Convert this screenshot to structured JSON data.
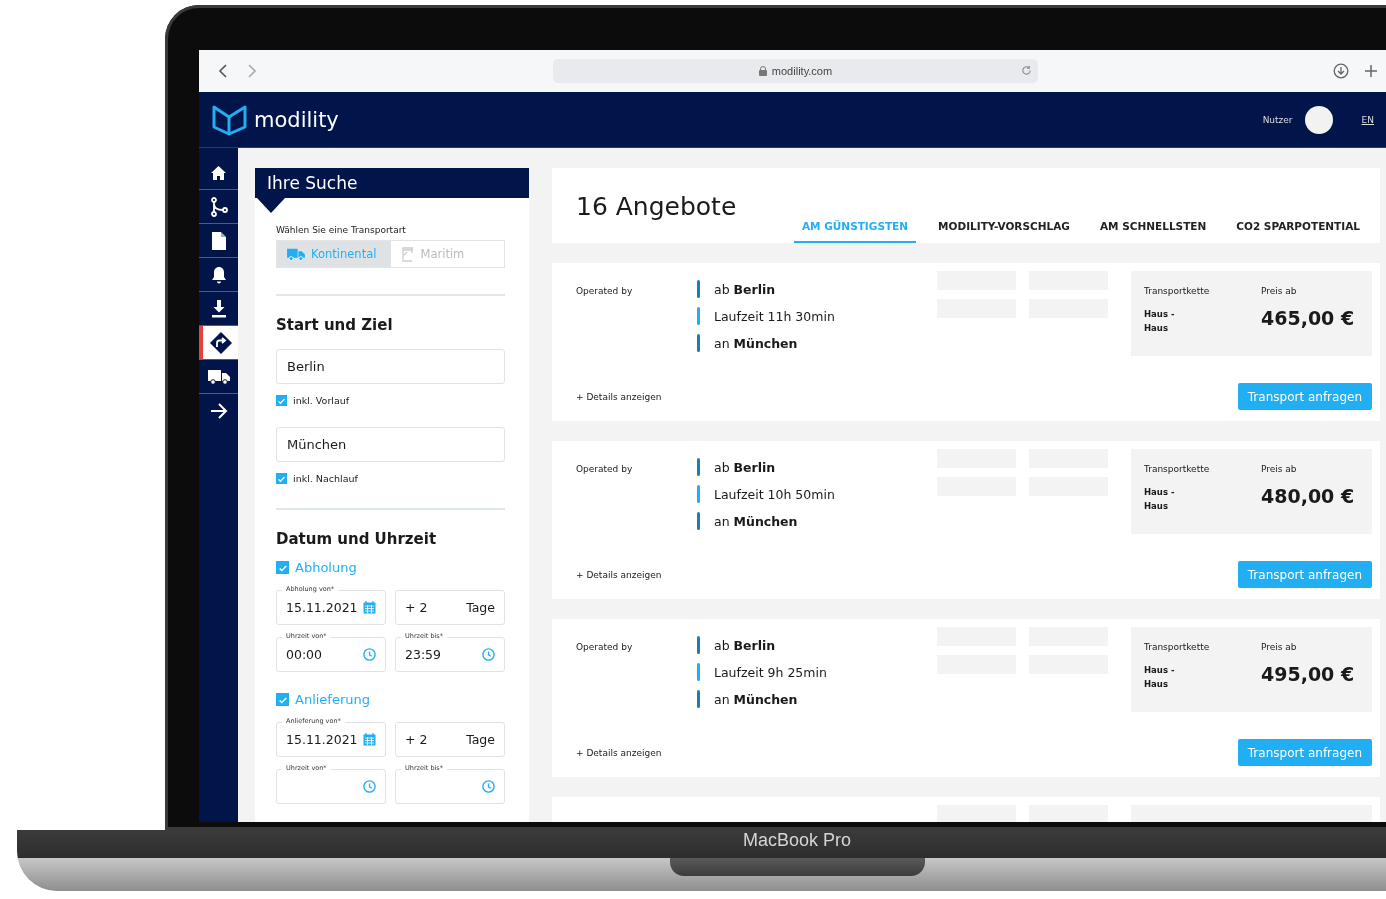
{
  "laptop": {
    "label": "MacBook Pro"
  },
  "browser": {
    "url": "modility.com"
  },
  "header": {
    "logo": "modility",
    "user_label": "Nutzer",
    "language": "EN"
  },
  "sidebar": {
    "items": [
      {
        "kind": "home",
        "selected": false
      },
      {
        "kind": "branch",
        "selected": false
      },
      {
        "kind": "document",
        "selected": false
      },
      {
        "kind": "bell",
        "selected": false
      },
      {
        "kind": "download",
        "selected": false
      },
      {
        "kind": "route",
        "selected": true
      },
      {
        "kind": "truck",
        "selected": false
      },
      {
        "kind": "arrow",
        "selected": false
      }
    ]
  },
  "search": {
    "title": "Ihre Suche",
    "transport_label": "Wählen Sie eine Transportart",
    "transport_modes": [
      {
        "label": "Kontinental",
        "kind": "truck",
        "selected": true
      },
      {
        "label": "Maritim",
        "kind": "crane",
        "selected": false
      }
    ],
    "route_title": "Start und Ziel",
    "route_fields": [
      {
        "value": "Berlin",
        "option": {
          "label": "inkl. Vorlauf",
          "checked": true
        }
      },
      {
        "value": "München",
        "option": {
          "label": "inkl. Nachlauf",
          "checked": true
        }
      }
    ],
    "schedule_title": "Datum und Uhrzeit",
    "schedule": [
      {
        "label": "Abholung",
        "checked": true,
        "date": {
          "label": "Abholung von*",
          "value": "15.11.2021"
        },
        "days": {
          "value": "+ 2",
          "unit": "Tage"
        },
        "time_from": {
          "label": "Uhrzeit von*",
          "value": "00:00"
        },
        "time_to": {
          "label": "Uhrzeit bis*",
          "value": "23:59"
        }
      },
      {
        "label": "Anlieferung",
        "checked": true,
        "date": {
          "label": "Anlieferung von*",
          "value": "15.11.2021"
        },
        "days": {
          "value": "+ 2",
          "unit": "Tage"
        },
        "time_from": {
          "label": "Uhrzeit von*"
        },
        "time_to": {
          "label": "Uhrzeit bis*"
        }
      }
    ]
  },
  "results": {
    "title": "16 Angebote",
    "tabs": [
      {
        "label": "AM GÜNSTIGSTEN",
        "selected": true
      },
      {
        "label": "MODILITY-VORSCHLAG",
        "selected": false
      },
      {
        "label": "AM SCHNELLSTEN",
        "selected": false
      },
      {
        "label": "CO2 SPARPOTENTIAL",
        "selected": false
      }
    ],
    "offers": [
      {
        "operator_label": "Operated by",
        "from": "ab **Berlin**",
        "duration": "Laufzeit 11h 30min",
        "to": "an **München**",
        "chain_label": "Transportkette",
        "chain": "Haus - Haus",
        "price_label": "Preis ab",
        "price": "465,00 €",
        "details": "+ Details anzeigen",
        "action": "Transport anfragen"
      },
      {
        "operator_label": "Operated by",
        "from": "ab **Berlin**",
        "duration": "Laufzeit 10h 50min",
        "to": "an **München**",
        "chain_label": "Transportkette",
        "chain": "Haus - Haus",
        "price_label": "Preis ab",
        "price": "480,00 €",
        "details": "+ Details anzeigen",
        "action": "Transport anfragen"
      },
      {
        "operator_label": "Operated by",
        "from": "ab **Berlin**",
        "duration": "Laufzeit 9h 25min",
        "to": "an **München**",
        "chain_label": "Transportkette",
        "chain": "Haus - Haus",
        "price_label": "Preis ab",
        "price": "495,00 €",
        "details": "+ Details anzeigen",
        "action": "Transport anfragen"
      }
    ]
  }
}
